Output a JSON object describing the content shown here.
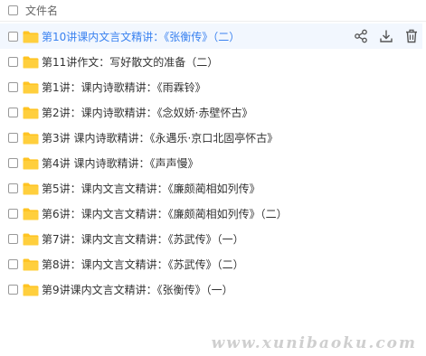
{
  "header": {
    "column_label": "文件名"
  },
  "files": [
    {
      "name": "第10讲课内文言文精讲：《张衡传》（二）",
      "active": true
    },
    {
      "name": "第11讲作文：写好散文的准备（二）"
    },
    {
      "name": "第1讲：课内诗歌精讲：《雨霖铃》"
    },
    {
      "name": "第2讲：课内诗歌精讲：《念奴娇·赤壁怀古》"
    },
    {
      "name": "第3讲 课内诗歌精讲：《永遇乐·京口北固亭怀古》"
    },
    {
      "name": "第4讲 课内诗歌精讲：《声声慢》"
    },
    {
      "name": "第5讲：课内文言文精讲：《廉颇蔺相如列传》"
    },
    {
      "name": "第6讲：课内文言文精讲：《廉颇蔺相如列传》（二）"
    },
    {
      "name": "第7讲：课内文言文精讲：《苏武传》（一）"
    },
    {
      "name": "第8讲：课内文言文精讲：《苏武传》（二）"
    },
    {
      "name": "第9讲课内文言文精讲：《张衡传》（一）"
    }
  ],
  "row_actions": [
    "share-icon",
    "download-icon",
    "delete-icon"
  ],
  "colors": {
    "accent": "#3a82f0",
    "folder": "#ffc423",
    "active_row": "#f2f7fe"
  },
  "watermark": "www.xunibaoku.com"
}
